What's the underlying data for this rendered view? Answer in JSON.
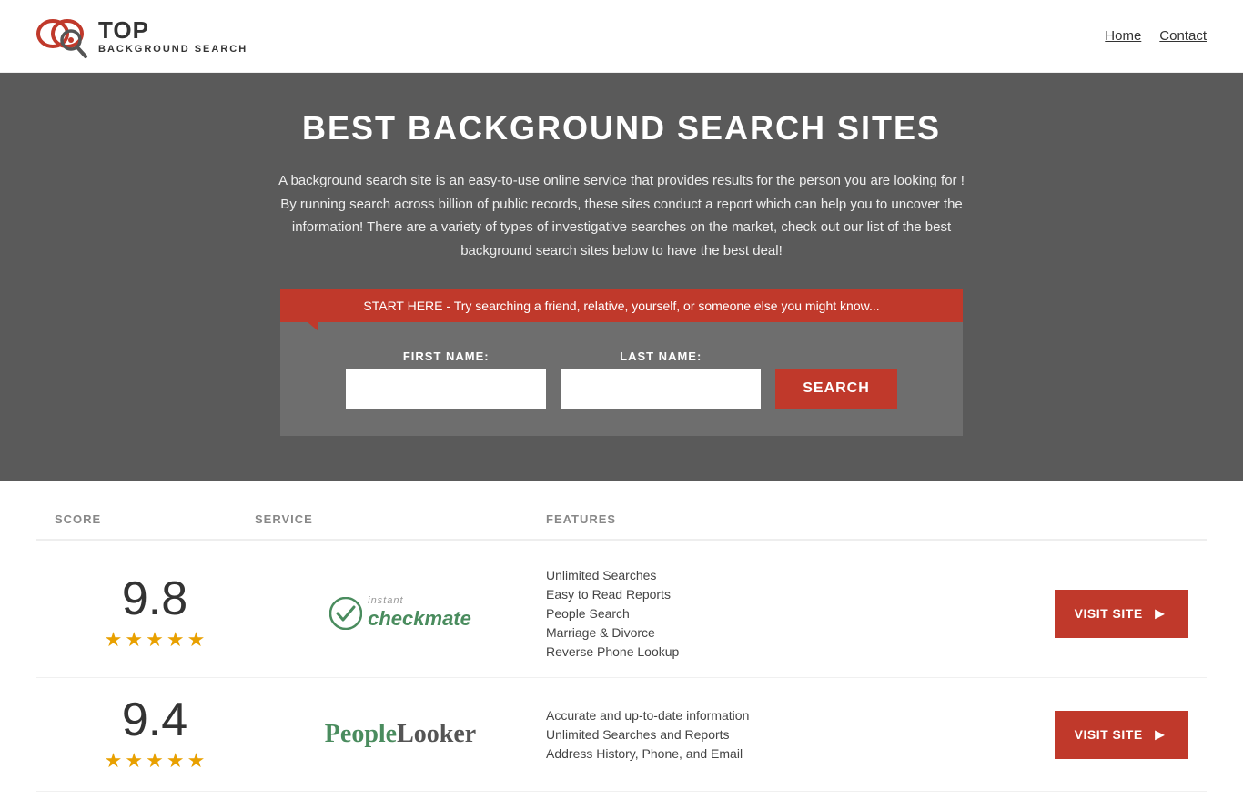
{
  "header": {
    "logo_top": "TOP",
    "logo_sub": "BACKGROUND SEARCH",
    "nav": {
      "home": "Home",
      "contact": "Contact"
    }
  },
  "hero": {
    "title": "BEST BACKGROUND SEARCH SITES",
    "description": "A background search site is an easy-to-use online service that provides results  for the person you are looking for ! By  running  search across billion of public records, these sites conduct  a report which can help you to uncover the information! There are a variety of types of investigative searches on the market, check out our  list of the best background search sites below to have the best deal!",
    "search_banner": "START HERE - Try searching a friend, relative, yourself, or someone else you might know...",
    "first_name_label": "FIRST NAME:",
    "last_name_label": "LAST NAME:",
    "search_button": "SEARCH"
  },
  "table": {
    "col_score": "SCORE",
    "col_service": "SERVICE",
    "col_features": "FEATURES"
  },
  "rows": [
    {
      "score": "9.8",
      "stars": 4.5,
      "service_name": "Instant Checkmate",
      "service_logo_type": "checkmate",
      "features": [
        "Unlimited Searches",
        "Easy to Read Reports",
        "People Search",
        "Marriage & Divorce",
        "Reverse Phone Lookup"
      ],
      "visit_label": "VISIT SITE"
    },
    {
      "score": "9.4",
      "stars": 4.5,
      "service_name": "PeopleLooker",
      "service_logo_type": "peoplelooker",
      "features": [
        "Accurate and up-to-date information",
        "Unlimited Searches and Reports",
        "Address History, Phone, and Email"
      ],
      "visit_label": "VISIT SITE"
    }
  ]
}
